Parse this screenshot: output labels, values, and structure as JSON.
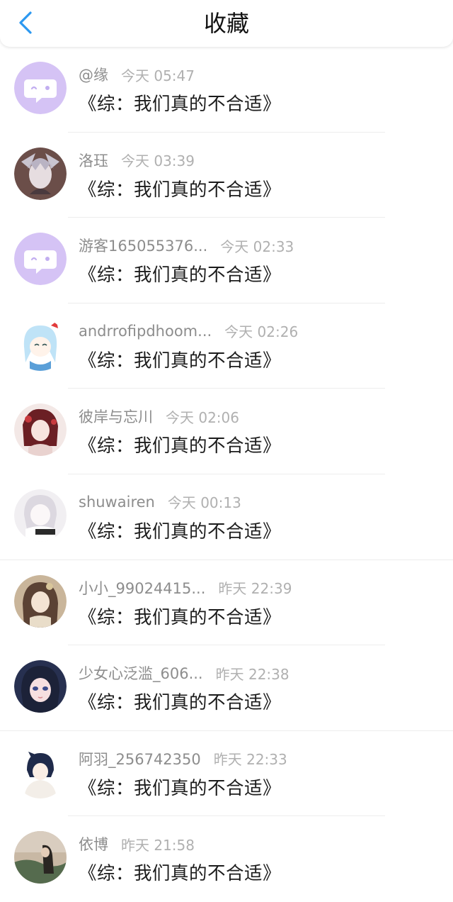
{
  "header": {
    "title": "收藏",
    "back_icon": "chevron-left-icon",
    "accent_color": "#2c98f0"
  },
  "items": [
    {
      "name": "@缘",
      "time": "今天 05:47",
      "title": "《综：我们真的不合适》",
      "avatar": "default-chat-avatar"
    },
    {
      "name": "洛珏",
      "time": "今天 03:39",
      "title": "《综：我们真的不合适》",
      "avatar": "user-avatar"
    },
    {
      "name": "游客165055376...",
      "time": "今天 02:33",
      "title": "《综：我们真的不合适》",
      "avatar": "default-chat-avatar"
    },
    {
      "name": "andrrofipdhoom...",
      "time": "今天 02:26",
      "title": "《综：我们真的不合适》",
      "avatar": "user-avatar"
    },
    {
      "name": "彼岸与忘川",
      "time": "今天 02:06",
      "title": "《综：我们真的不合适》",
      "avatar": "user-avatar"
    },
    {
      "name": "shuwairen",
      "time": "今天 00:13",
      "title": "《综：我们真的不合适》",
      "avatar": "user-avatar"
    },
    {
      "name": "小小_99024415...",
      "time": "昨天 22:39",
      "title": "《综：我们真的不合适》",
      "avatar": "user-avatar"
    },
    {
      "name": "少女心泛滥_606...",
      "time": "昨天 22:38",
      "title": "《综：我们真的不合适》",
      "avatar": "user-avatar"
    },
    {
      "name": "阿羽_256742350",
      "time": "昨天 22:33",
      "title": "《综：我们真的不合适》",
      "avatar": "user-avatar"
    },
    {
      "name": "依博",
      "time": "昨天 21:58",
      "title": "《综：我们真的不合适》",
      "avatar": "user-avatar"
    }
  ]
}
